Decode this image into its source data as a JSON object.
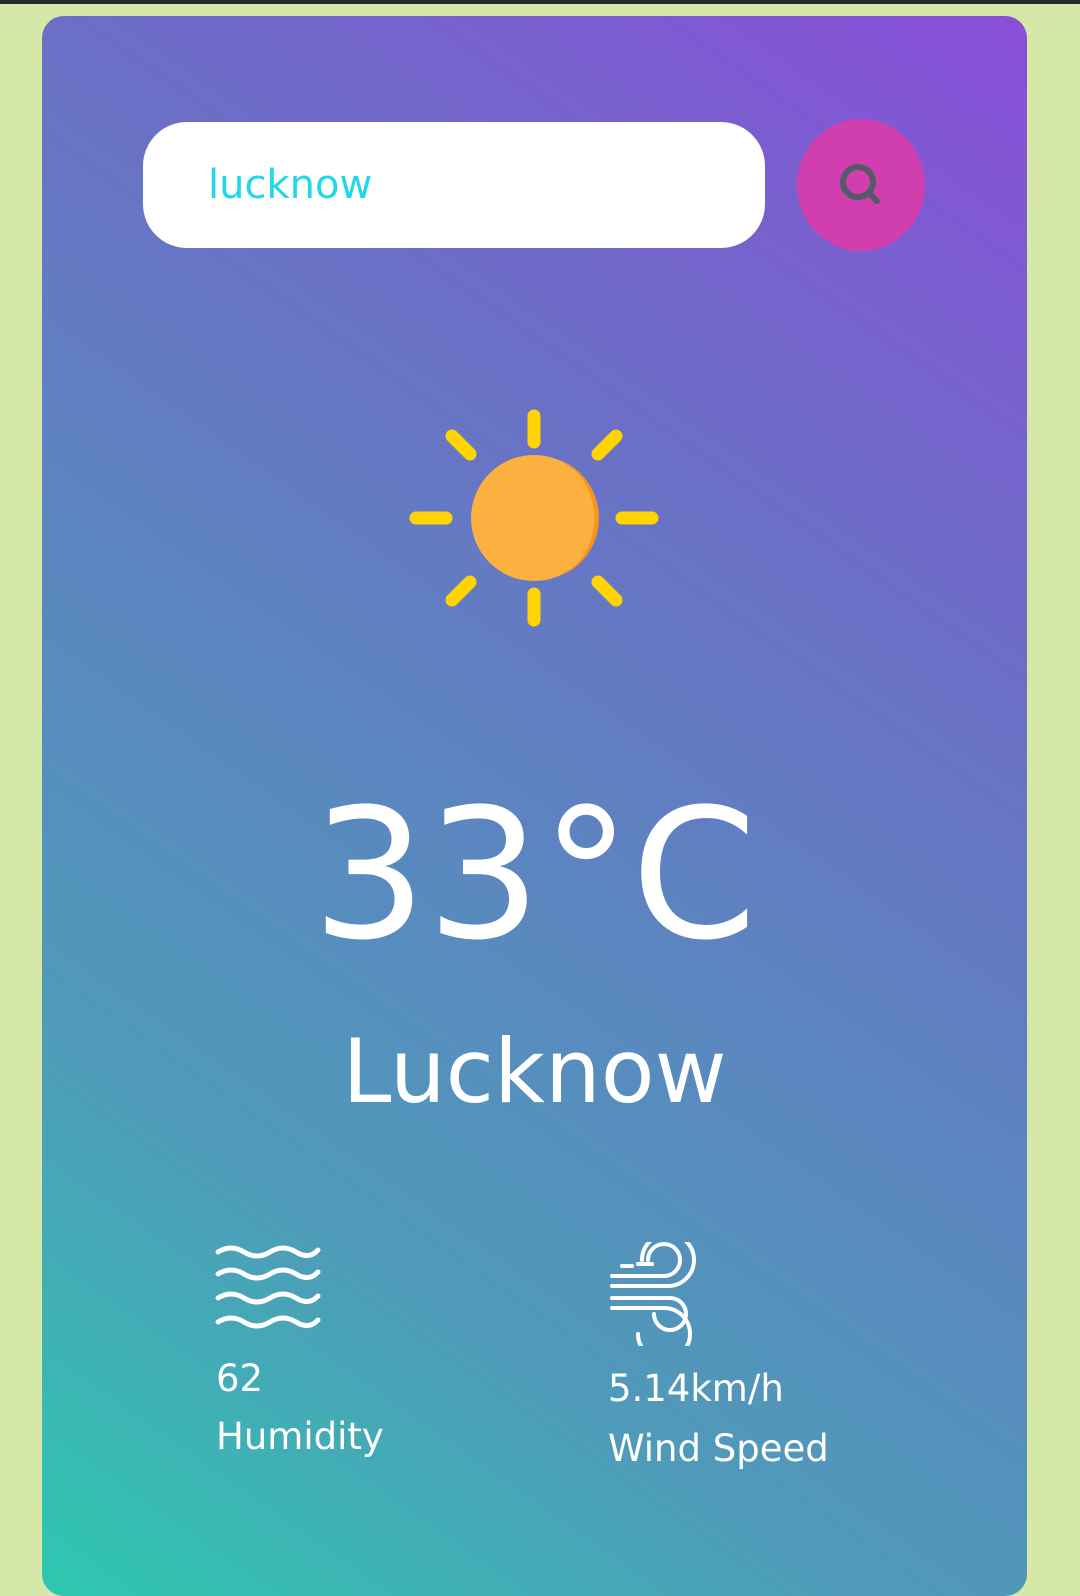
{
  "search": {
    "value": "lucknow",
    "button_icon": "search-icon"
  },
  "weather": {
    "icon": "sun-icon",
    "temperature": "33°C",
    "city": "Lucknow"
  },
  "stats": {
    "humidity": {
      "icon": "humidity-waves-icon",
      "value": "62",
      "label": "Humidity"
    },
    "wind": {
      "icon": "wind-icon",
      "value": "5.14km/h",
      "label": "Wind Speed"
    }
  },
  "colors": {
    "page_background": "#d6e8a7",
    "card_gradient_top": "#8a4ed9",
    "card_gradient_bottom": "#2ec8b0",
    "search_text": "#1fd8e8",
    "search_button": "#d13fae",
    "sun_body": "#fbb040",
    "sun_rays": "#ffd400"
  }
}
